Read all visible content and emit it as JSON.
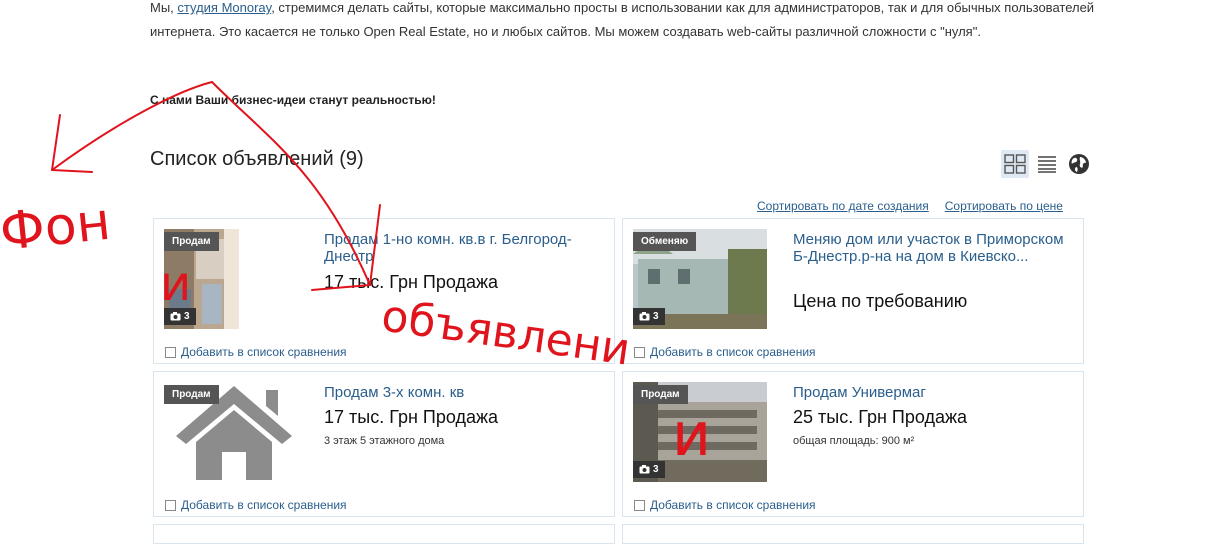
{
  "intro": {
    "prefix": "Мы, ",
    "link": "студия Monoray",
    "suffix": ", стремимся делать сайты, которые максимально просты в использовании как для администраторов, так и для обычных пользователей интернета. Это касается не только Open Real Estate, но и любых сайтов. Мы можем создавать web-сайты различной сложности с \"нуля\".",
    "motto": "С нами Ваши бизнес-идеи станут реальностью!"
  },
  "listing": {
    "title": "Список объявлений (9)",
    "views": [
      {
        "icon": "grid-view-icon",
        "active": true
      },
      {
        "icon": "list-view-icon",
        "active": false
      },
      {
        "icon": "globe-map-icon",
        "active": false
      }
    ],
    "sort": [
      "Сортировать по дате создания",
      "Сортировать по цене"
    ]
  },
  "cards": [
    {
      "badge": "Продам",
      "photos": "3",
      "title": "Продам 1-но комн. кв.в г. Белгород-Днестр",
      "price": "17 тыс. Грн Продажа",
      "extra": "",
      "compare": "Добавить в список сравнения"
    },
    {
      "badge": "Обменяю",
      "photos": "3",
      "title": "Меняю дом или участок в Приморском Б-Днестр.р-на на дом в Киевско...",
      "price": "Цена по требованию",
      "extra": "",
      "compare": "Добавить в список сравнения"
    },
    {
      "badge": "Продам",
      "photos": "",
      "title": "Продам 3-х комн. кв",
      "price": "17 тыс. Грн Продажа",
      "extra": "3 этаж 5 этажного дома",
      "compare": "Добавить в список сравнения"
    },
    {
      "badge": "Продам",
      "photos": "3",
      "title": "Продам Универмаг",
      "price": "25 тыс. Грн Продажа",
      "extra": "общая площадь: 900 м²",
      "compare": "Добавить в список сравнения"
    }
  ],
  "annotations": {
    "fon": "Фон",
    "i1": "и",
    "obyavleniya": "объявлени",
    "i2": "и"
  },
  "colors": {
    "link": "#2a5e8c",
    "card_border": "#d8e4ee",
    "annotation": "#e0141c"
  }
}
